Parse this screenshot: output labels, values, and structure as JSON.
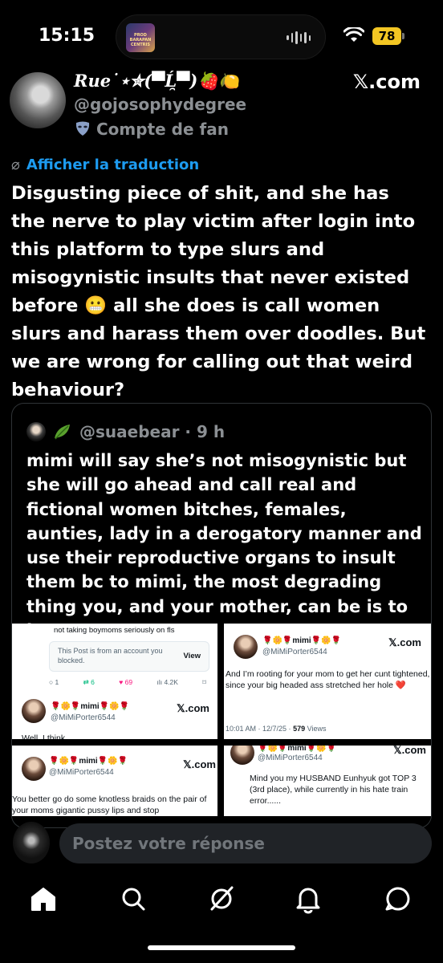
{
  "status": {
    "time": "15:15",
    "battery": "78",
    "island_thumb_text": "PROD BARAPAN CENTRIS"
  },
  "header": {
    "display_name": "Rue˙⋆✮(▀̿Ĺ̯▀̿)🍓🍋",
    "handle": "@gojosophydegree",
    "badge": "Compte de fan",
    "site": "𝕏.com"
  },
  "translate": "Afficher la traduction",
  "tweet": {
    "text": "Disgusting piece of shit, and she has the nerve to play victim after login into this platform to type slurs and misogynistic insults that never existed before 😬 all she does is call women slurs and harass them over doodles. But we are wrong for calling out that weird behaviour?"
  },
  "quote": {
    "handle": "@suaebear",
    "time": "· 9 h",
    "text": "mimi will say she’s not misogynistic but she will go ahead and call real and fictional women bitches, females, aunties, lady in a derogatory manner and use their reproductive organs to insult them bc to mimi, the most degrading thing you, and your mother, can be is to be a woman"
  },
  "media": {
    "card1": {
      "top_text": "not taking boymoms seriously on fls",
      "blocked_text": "This Post is from an account you blocked.",
      "view": "View",
      "metrics": [
        "1",
        "6",
        "69",
        "4.2K"
      ],
      "name": "🌹🌼🌹mimi🌹🌼🌹",
      "handle": "@MiMiPorter6544",
      "site": "𝕏.com",
      "cut_text": "Well, I think"
    },
    "card2": {
      "name": "🌹🌼🌹mimi🌹🌼🌹",
      "handle": "@MiMiPorter6544",
      "site": "𝕏.com",
      "text": "And I’m rooting for your mom to get her cunt tightened, since your big headed ass stretched her hole ❤️",
      "time": "10:01 AM · 12/7/25 ·",
      "views_num": "579",
      "views": "Views"
    },
    "card3": {
      "name": "🌹🌼🌹mimi🌹🌼🌹",
      "handle": "@MiMiPorter6544",
      "site": "𝕏.com",
      "text": "You better go do some knotless braids on the pair of your moms gigantic pussy lips and stop"
    },
    "card4": {
      "name": "🌹🌼🌹mimi🌹🌼🌹",
      "handle": "@MiMiPorter6544",
      "site": "𝕏.com",
      "text": "Mind you my HUSBAND Eunhyuk got TOP 3 (3rd place),  while currently in his hate train error......"
    }
  },
  "reply": {
    "placeholder": "Postez votre réponse"
  },
  "nav": [
    "home-icon",
    "search-icon",
    "grok-icon",
    "notifications-icon",
    "messages-icon"
  ],
  "colors": {
    "link": "#1d9bf0",
    "muted": "#8b8f93",
    "battery": "#f3c623"
  }
}
